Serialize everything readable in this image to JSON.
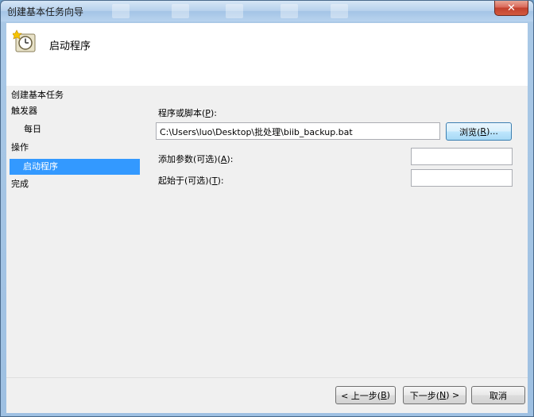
{
  "window": {
    "title": "创建基本任务向导",
    "close_symbol": "✕"
  },
  "header": {
    "title": "启动程序",
    "icon": "task-scheduler-clock-icon"
  },
  "wizard": {
    "caption": "创建基本任务"
  },
  "nav": {
    "items": [
      {
        "label": "触发器"
      },
      {
        "label": "每日"
      },
      {
        "label": "操作"
      },
      {
        "label": "启动程序"
      },
      {
        "label": "完成"
      }
    ]
  },
  "form": {
    "program_label_pre": "程序或脚本(",
    "program_label_key": "P",
    "program_label_post": "):",
    "program_value": "C:\\Users\\luo\\Desktop\\批处理\\biib_backup.bat",
    "browse_pre": "浏览(",
    "browse_key": "R",
    "browse_post": ")...",
    "args_label_pre": "添加参数(可选)(",
    "args_label_key": "A",
    "args_label_post": "):",
    "args_value": "",
    "start_label_pre": "起始于(可选)(",
    "start_label_key": "T",
    "start_label_post": "):",
    "start_value": ""
  },
  "footer": {
    "back_pre": "< 上一步(",
    "back_key": "B",
    "back_post": ")",
    "next_pre": "下一步(",
    "next_key": "N",
    "next_post": ") >",
    "cancel_label": "取消"
  },
  "colors": {
    "selection": "#3399ff",
    "close_red": "#c2412e"
  }
}
